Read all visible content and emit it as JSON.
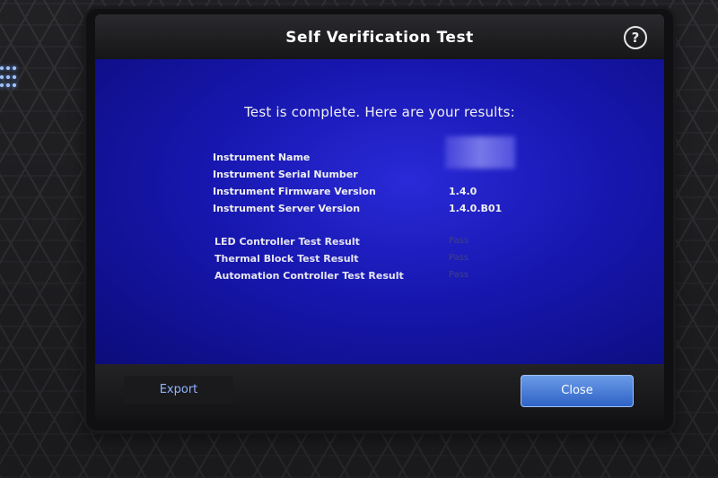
{
  "window": {
    "title": "Self Verification Test",
    "help_icon": "?"
  },
  "main": {
    "headline": "Test is complete. Here are your results:",
    "info_rows": [
      {
        "label": "Instrument Name",
        "value": ""
      },
      {
        "label": "Instrument Serial Number",
        "value": ""
      },
      {
        "label": "Instrument Firmware Version",
        "value": "1.4.0"
      },
      {
        "label": "Instrument Server Version",
        "value": "1.4.0.B01"
      }
    ],
    "result_rows": [
      {
        "label": "LED Controller Test Result",
        "value": "Pass"
      },
      {
        "label": "Thermal Block Test Result",
        "value": "Pass"
      },
      {
        "label": "Automation Controller Test Result",
        "value": "Pass"
      }
    ]
  },
  "footer": {
    "export_label": "Export",
    "close_label": "Close"
  },
  "colors": {
    "screen_blue": "#1717b0",
    "close_button": "#3f73d2",
    "export_text": "#8fb4ff"
  }
}
